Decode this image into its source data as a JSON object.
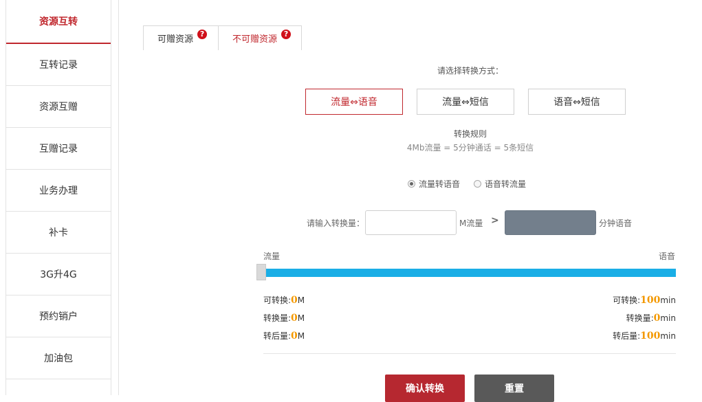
{
  "sidebar": {
    "items": [
      {
        "label": "资源互转",
        "active": true
      },
      {
        "label": "互转记录"
      },
      {
        "label": "资源互赠"
      },
      {
        "label": "互赠记录"
      },
      {
        "label": "业务办理"
      },
      {
        "label": "补卡"
      },
      {
        "label": "3G升4G"
      },
      {
        "label": "预约销户"
      },
      {
        "label": "加油包"
      }
    ]
  },
  "tabs": [
    {
      "label": "可赠资源",
      "help": "?"
    },
    {
      "label": "不可赠资源",
      "help": "?",
      "active": true
    }
  ],
  "mode": {
    "prompt": "请选择转换方式：",
    "options": [
      "流量⇔语音",
      "流量⇔短信",
      "语音⇔短信"
    ],
    "active_index": 0
  },
  "rule": {
    "title": "转换规则",
    "text": "4Mb流量 = 5分钟通话 = 5条短信"
  },
  "direction": {
    "options": [
      "流量转语音",
      "语音转流量"
    ],
    "selected_index": 0
  },
  "input": {
    "label": "请输入转换量：",
    "value": "",
    "unit": "M流量",
    "arrow": ">",
    "result_unit": "分钟语音"
  },
  "slider": {
    "left_label": "流量",
    "right_label": "语音",
    "value_fraction": 0
  },
  "stats_left": [
    {
      "label": "可转换:",
      "value": "0",
      "unit": "M"
    },
    {
      "label": "转换量:",
      "value": "0",
      "unit": "M"
    },
    {
      "label": "转后量:",
      "value": "0",
      "unit": "M"
    }
  ],
  "stats_right": [
    {
      "label": "可转换:",
      "value": "100",
      "unit": "min"
    },
    {
      "label": "转换量:",
      "value": "0",
      "unit": "min"
    },
    {
      "label": "转后量:",
      "value": "100",
      "unit": "min"
    }
  ],
  "buttons": {
    "confirm": "确认转换",
    "reset": "重置"
  },
  "colors": {
    "accent": "#c0272d",
    "slider": "#1aaee6",
    "highlight_number": "#f39800",
    "reset_button": "#595959"
  }
}
